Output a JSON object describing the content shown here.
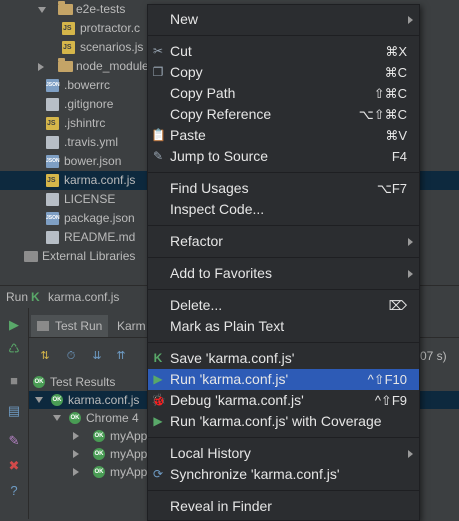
{
  "tree": {
    "items": [
      {
        "label": "e2e-tests",
        "type": "folder",
        "indent": 1,
        "arrow": "down"
      },
      {
        "label": "protractor.c",
        "type": "js",
        "indent": 3
      },
      {
        "label": "scenarios.js",
        "type": "js",
        "indent": 3
      },
      {
        "label": "node_modules",
        "type": "folder",
        "indent": 1,
        "arrow": "right"
      },
      {
        "label": ".bowerrc",
        "type": "json",
        "indent": 2
      },
      {
        "label": ".gitignore",
        "type": "txt",
        "indent": 2
      },
      {
        "label": ".jshintrc",
        "type": "js",
        "indent": 2
      },
      {
        "label": ".travis.yml",
        "type": "txt",
        "indent": 2
      },
      {
        "label": "bower.json",
        "type": "json",
        "indent": 2
      },
      {
        "label": "karma.conf.js",
        "type": "js",
        "indent": 2,
        "selected": true
      },
      {
        "label": "LICENSE",
        "type": "txt",
        "indent": 2
      },
      {
        "label": "package.json",
        "type": "json",
        "indent": 2
      },
      {
        "label": "README.md",
        "type": "txt",
        "indent": 2
      },
      {
        "label": "External Libraries",
        "type": "libs",
        "indent": 0
      }
    ]
  },
  "runbar": {
    "prefix": "Run",
    "config": "karma.conf.js"
  },
  "runpanel": {
    "tabs": [
      {
        "label": "Test Run"
      },
      {
        "label": "Karm"
      }
    ],
    "duration": "07 s)",
    "results": [
      {
        "label": "Test Results",
        "indent": 0
      },
      {
        "label": "karma.conf.js",
        "indent": 1,
        "selected": true
      },
      {
        "label": "Chrome 4",
        "indent": 2
      },
      {
        "label": "myApp",
        "indent": 3
      },
      {
        "label": "myApp",
        "indent": 3
      },
      {
        "label": "myApp",
        "indent": 3
      }
    ]
  },
  "menu": {
    "items": [
      {
        "label": "New",
        "submenu": true
      },
      {
        "sep": true
      },
      {
        "label": "Cut",
        "shortcut": "⌘X",
        "icon": "scissors-icon",
        "glyph": "✂"
      },
      {
        "label": "Copy",
        "shortcut": "⌘C",
        "icon": "copy-icon",
        "glyph": "❐"
      },
      {
        "label": "Copy Path",
        "shortcut": "⇧⌘C"
      },
      {
        "label": "Copy Reference",
        "shortcut": "⌥⇧⌘C"
      },
      {
        "label": "Paste",
        "shortcut": "⌘V",
        "icon": "paste-icon",
        "glyph": "📋"
      },
      {
        "label": "Jump to Source",
        "shortcut": "F4",
        "icon": "jump-to-source-icon",
        "glyph": "✎"
      },
      {
        "sep": true
      },
      {
        "label": "Find Usages",
        "shortcut": "⌥F7"
      },
      {
        "label": "Inspect Code..."
      },
      {
        "sep": true
      },
      {
        "label": "Refactor",
        "submenu": true
      },
      {
        "sep": true
      },
      {
        "label": "Add to Favorites",
        "submenu": true
      },
      {
        "sep": true
      },
      {
        "label": "Delete...",
        "shortcut": "⌦"
      },
      {
        "label": "Mark as Plain Text"
      },
      {
        "sep": true
      },
      {
        "label": "Save 'karma.conf.js'",
        "icon": "karma-icon",
        "glyph": "K"
      },
      {
        "label": "Run 'karma.conf.js'",
        "shortcut": "^⇧F10",
        "icon": "run-icon",
        "glyph": "▶",
        "highlighted": true
      },
      {
        "label": "Debug 'karma.conf.js'",
        "shortcut": "^⇧F9",
        "icon": "debug-icon",
        "glyph": "🐞"
      },
      {
        "label": "Run 'karma.conf.js' with Coverage",
        "icon": "coverage-icon",
        "glyph": "▶"
      },
      {
        "sep": true
      },
      {
        "label": "Local History",
        "submenu": true
      },
      {
        "label": "Synchronize 'karma.conf.js'",
        "icon": "sync-icon",
        "glyph": "⟳"
      },
      {
        "sep": true
      },
      {
        "label": "Reveal in Finder"
      }
    ]
  },
  "colors": {
    "highlight": "#2d5bb6",
    "selection": "#0d293e",
    "ok": "#499c54",
    "run": "#59a869"
  }
}
